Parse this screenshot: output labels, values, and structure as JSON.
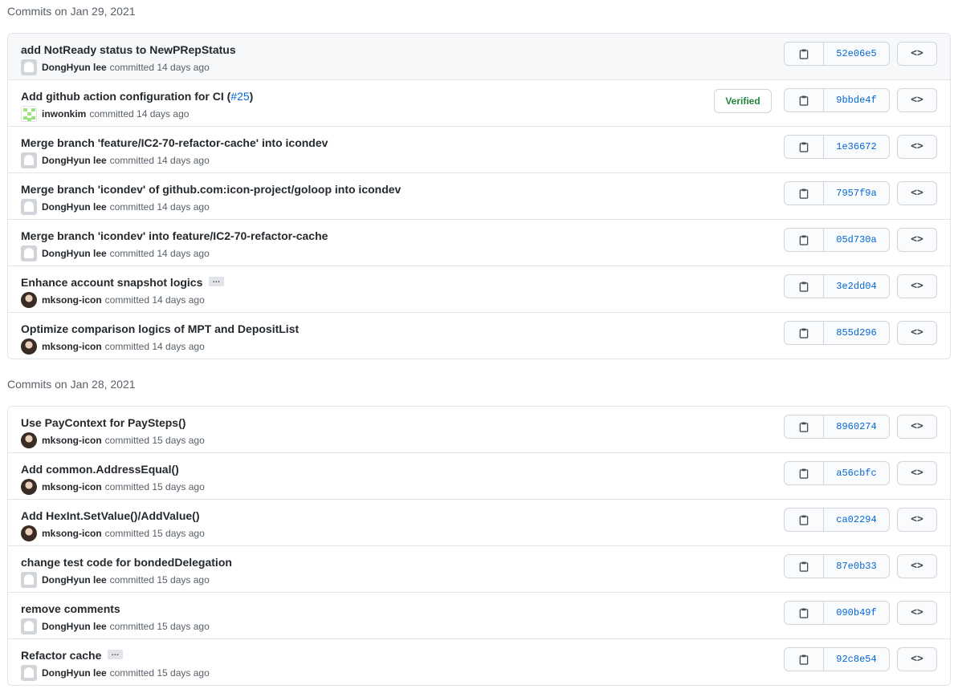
{
  "groups": [
    {
      "heading": "Commits on Jan 29, 2021",
      "commits": [
        {
          "message": "add NotReady status to NewPRepStatus",
          "link": "",
          "link_suffix": "",
          "author": "DongHyun lee",
          "committed": "committed 14 days ago",
          "sha": "52e06e5",
          "verified": "",
          "avatar": "ghost",
          "ellipsis": false,
          "highlight": true
        },
        {
          "message": "Add github action configuration for CI (",
          "link": "#25",
          "link_suffix": ")",
          "author": "inwonkim",
          "committed": "committed 14 days ago",
          "sha": "9bbde4f",
          "verified": "Verified",
          "avatar": "identicon",
          "ellipsis": false,
          "highlight": false
        },
        {
          "message": "Merge branch 'feature/IC2-70-refactor-cache' into icondev",
          "link": "",
          "link_suffix": "",
          "author": "DongHyun lee",
          "committed": "committed 14 days ago",
          "sha": "1e36672",
          "verified": "",
          "avatar": "ghost",
          "ellipsis": false,
          "highlight": false
        },
        {
          "message": "Merge branch 'icondev' of github.com:icon-project/goloop into icondev",
          "link": "",
          "link_suffix": "",
          "author": "DongHyun lee",
          "committed": "committed 14 days ago",
          "sha": "7957f9a",
          "verified": "",
          "avatar": "ghost",
          "ellipsis": false,
          "highlight": false
        },
        {
          "message": "Merge branch 'icondev' into feature/IC2-70-refactor-cache",
          "link": "",
          "link_suffix": "",
          "author": "DongHyun lee",
          "committed": "committed 14 days ago",
          "sha": "05d730a",
          "verified": "",
          "avatar": "ghost",
          "ellipsis": false,
          "highlight": false
        },
        {
          "message": "Enhance account snapshot logics",
          "link": "",
          "link_suffix": "",
          "author": "mksong-icon",
          "committed": "committed 14 days ago",
          "sha": "3e2dd04",
          "verified": "",
          "avatar": "photo",
          "ellipsis": true,
          "highlight": false
        },
        {
          "message": "Optimize comparison logics of MPT and DepositList",
          "link": "",
          "link_suffix": "",
          "author": "mksong-icon",
          "committed": "committed 14 days ago",
          "sha": "855d296",
          "verified": "",
          "avatar": "photo",
          "ellipsis": false,
          "highlight": false
        }
      ]
    },
    {
      "heading": "Commits on Jan 28, 2021",
      "commits": [
        {
          "message": "Use PayContext for PaySteps()",
          "link": "",
          "link_suffix": "",
          "author": "mksong-icon",
          "committed": "committed 15 days ago",
          "sha": "8960274",
          "verified": "",
          "avatar": "photo",
          "ellipsis": false,
          "highlight": false
        },
        {
          "message": "Add common.AddressEqual()",
          "link": "",
          "link_suffix": "",
          "author": "mksong-icon",
          "committed": "committed 15 days ago",
          "sha": "a56cbfc",
          "verified": "",
          "avatar": "photo",
          "ellipsis": false,
          "highlight": false
        },
        {
          "message": "Add HexInt.SetValue()/AddValue()",
          "link": "",
          "link_suffix": "",
          "author": "mksong-icon",
          "committed": "committed 15 days ago",
          "sha": "ca02294",
          "verified": "",
          "avatar": "photo",
          "ellipsis": false,
          "highlight": false
        },
        {
          "message": "change test code for bondedDelegation",
          "link": "",
          "link_suffix": "",
          "author": "DongHyun lee",
          "committed": "committed 15 days ago",
          "sha": "87e0b33",
          "verified": "",
          "avatar": "ghost",
          "ellipsis": false,
          "highlight": false
        },
        {
          "message": "remove comments",
          "link": "",
          "link_suffix": "",
          "author": "DongHyun lee",
          "committed": "committed 15 days ago",
          "sha": "090b49f",
          "verified": "",
          "avatar": "ghost",
          "ellipsis": false,
          "highlight": false
        },
        {
          "message": "Refactor cache",
          "link": "",
          "link_suffix": "",
          "author": "DongHyun lee",
          "committed": "committed 15 days ago",
          "sha": "92c8e54",
          "verified": "",
          "avatar": "ghost",
          "ellipsis": true,
          "highlight": false
        }
      ]
    }
  ],
  "ellipsis_label": "…",
  "browse_label": "<>",
  "colors": {
    "link": "#0366d6",
    "verified": "#22863a",
    "border": "#e1e4e8",
    "muted": "#586069"
  }
}
